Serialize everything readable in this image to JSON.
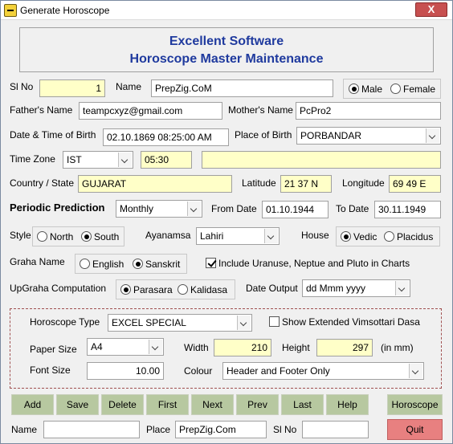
{
  "window": {
    "title": "Generate Horoscope",
    "close_label": "X"
  },
  "header": {
    "line1": "Excellent Software",
    "line2": "Horoscope Master Maintenance"
  },
  "form": {
    "sl_no": {
      "label": "Sl No",
      "value": "1"
    },
    "name": {
      "label": "Name",
      "value": "PrepZig.CoM"
    },
    "gender": {
      "male_label": "Male",
      "female_label": "Female",
      "selected": "Male"
    },
    "fathers_name": {
      "label": "Father's Name",
      "value": "teampcxyz@gmail.com"
    },
    "mothers_name": {
      "label": "Mother's Name",
      "value": "PcPro2"
    },
    "birth_datetime": {
      "label": "Date & Time of Birth",
      "value": "02.10.1869 08:25:00 AM"
    },
    "place_of_birth": {
      "label": "Place of Birth",
      "value": "PORBANDAR"
    },
    "time_zone": {
      "label": "Time Zone",
      "value": "IST",
      "offset": "05:30",
      "extra": ""
    },
    "country_state": {
      "label": "Country / State",
      "value": "GUJARAT"
    },
    "latitude": {
      "label": "Latitude",
      "value": "21 37 N"
    },
    "longitude": {
      "label": "Longitude",
      "value": "69 49 E"
    },
    "periodic": {
      "label": "Periodic Prediction",
      "value": "Monthly"
    },
    "from_date": {
      "label": "From Date",
      "value": "01.10.1944"
    },
    "to_date": {
      "label": "To Date",
      "value": "30.11.1949"
    },
    "style": {
      "label": "Style",
      "north_label": "North",
      "south_label": "South",
      "selected": "South"
    },
    "ayanamsa": {
      "label": "Ayanamsa",
      "value": "Lahiri"
    },
    "house": {
      "label": "House",
      "vedic_label": "Vedic",
      "placidus_label": "Placidus",
      "selected": "Vedic"
    },
    "graha_name": {
      "label": "Graha Name",
      "english_label": "English",
      "sanskrit_label": "Sanskrit",
      "selected": "Sanskrit"
    },
    "include_planets": {
      "label": "Include Uranuse, Neptue and Pluto in Charts",
      "checked": true
    },
    "upgraha": {
      "label": "UpGraha Computation",
      "parasara_label": "Parasara",
      "kalidasa_label": "Kalidasa",
      "selected": "Parasara"
    },
    "date_output": {
      "label": "Date Output",
      "value": "dd Mmm yyyy"
    }
  },
  "options": {
    "horoscope_type": {
      "label": "Horoscope Type",
      "value": "EXCEL SPECIAL"
    },
    "show_extended": {
      "label": "Show Extended Vimsottari Dasa",
      "checked": false
    },
    "paper_size": {
      "label": "Paper Size",
      "value": "A4"
    },
    "width": {
      "label": "Width",
      "value": "210"
    },
    "height": {
      "label": "Height",
      "value": "297"
    },
    "unit_note": "(in mm)",
    "font_size": {
      "label": "Font Size",
      "value": "10.00"
    },
    "colour": {
      "label": "Colour",
      "value": "Header and Footer Only"
    }
  },
  "buttons": {
    "add": "Add",
    "save": "Save",
    "delete": "Delete",
    "first": "First",
    "next": "Next",
    "prev": "Prev",
    "last": "Last",
    "help": "Help",
    "horoscope": "Horoscope",
    "quit": "Quit"
  },
  "search": {
    "name_label": "Name",
    "name_value": "",
    "place_label": "Place",
    "place_value": "PrepZig.Com",
    "slno_label": "Sl No",
    "slno_value": ""
  },
  "colors": {
    "header_text": "#1f3a9e",
    "highlight_field": "#ffffc8",
    "nav_button": "#b7c8a0",
    "quit_button": "#e88080",
    "close_button": "#c75050"
  }
}
